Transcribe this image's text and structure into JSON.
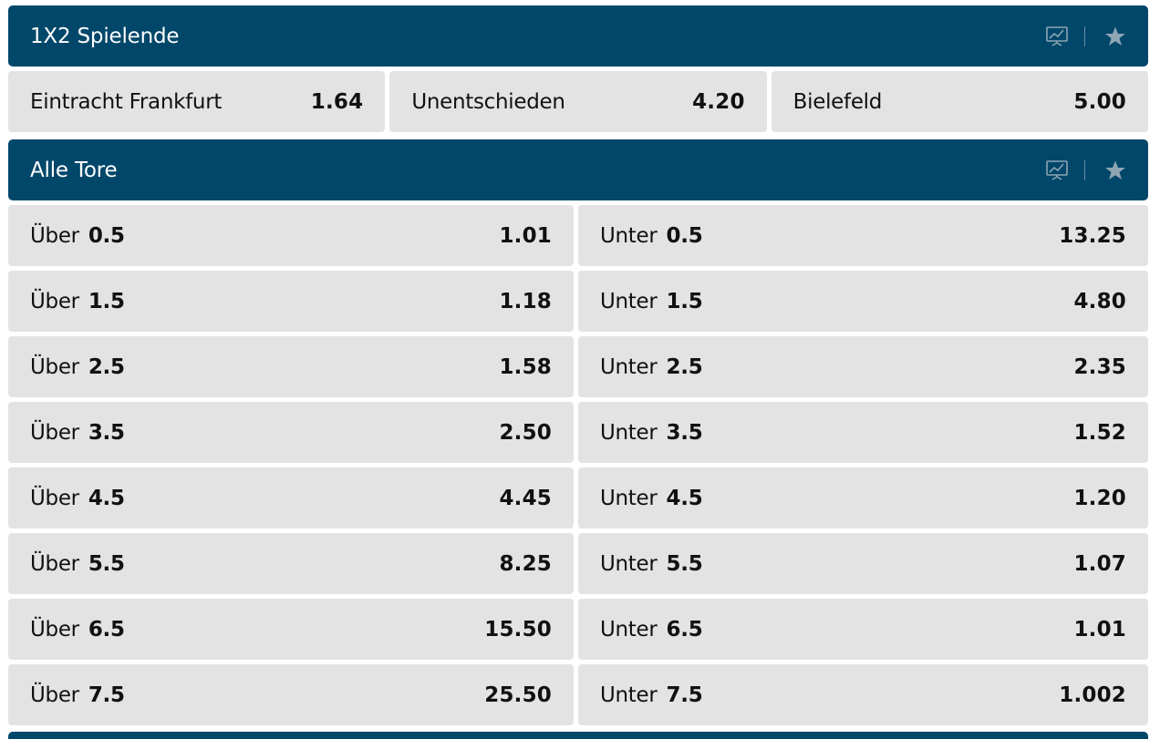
{
  "colors": {
    "header_bg": "#00476a",
    "tile_bg": "#e3e3e3",
    "icon_gray": "#8ea5b4"
  },
  "markets": [
    {
      "title": "1X2 Spielende",
      "outcomes": [
        {
          "label": "Eintracht Frankfurt",
          "odd": "1.64"
        },
        {
          "label": "Unentschieden",
          "odd": "4.20"
        },
        {
          "label": "Bielefeld",
          "odd": "5.00"
        }
      ]
    },
    {
      "title": "Alle Tore",
      "over_label": "Über",
      "under_label": "Unter",
      "rows": [
        {
          "line": "0.5",
          "over": "1.01",
          "under": "13.25"
        },
        {
          "line": "1.5",
          "over": "1.18",
          "under": "4.80"
        },
        {
          "line": "2.5",
          "over": "1.58",
          "under": "2.35"
        },
        {
          "line": "3.5",
          "over": "2.50",
          "under": "1.52"
        },
        {
          "line": "4.5",
          "over": "4.45",
          "under": "1.20"
        },
        {
          "line": "5.5",
          "over": "8.25",
          "under": "1.07"
        },
        {
          "line": "6.5",
          "over": "15.50",
          "under": "1.01"
        },
        {
          "line": "7.5",
          "over": "25.50",
          "under": "1.002"
        }
      ]
    }
  ],
  "icons": {
    "stats": "stats-chart-icon",
    "favorite": "star-icon"
  }
}
